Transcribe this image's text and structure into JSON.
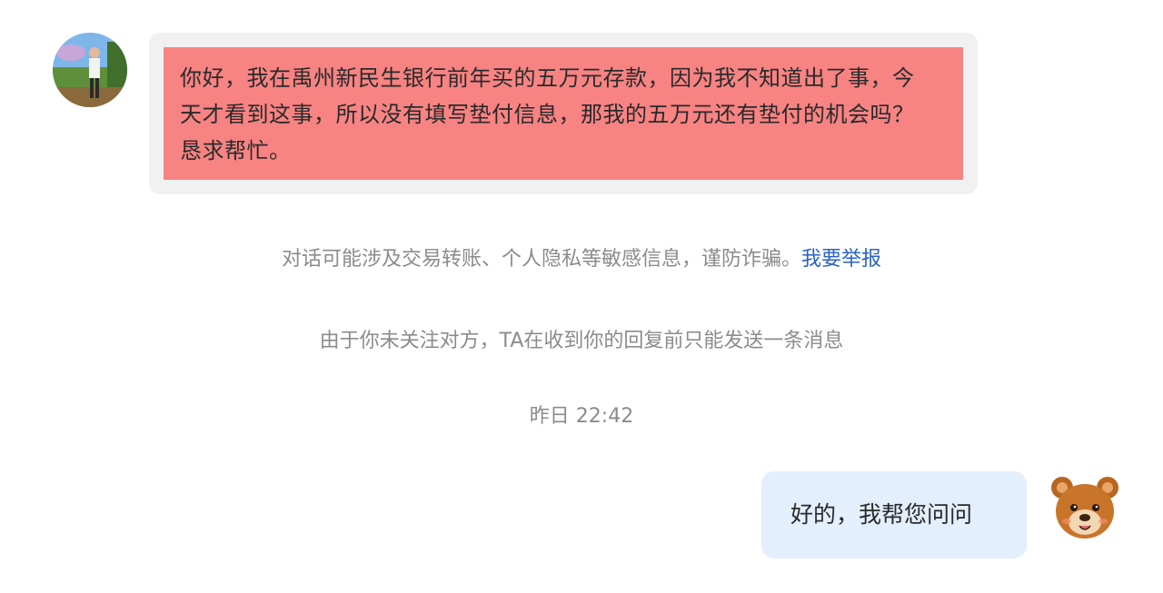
{
  "incoming_message": {
    "text": "你好，我在禹州新民生银行前年买的五万元存款，因为我不知道出了事，今天才看到这事，所以没有填写垫付信息，那我的五万元还有垫付的机会吗？恳求帮忙。"
  },
  "notices": {
    "fraud_warning": "对话可能涉及交易转账、个人隐私等敏感信息，谨防诈骗。",
    "report_link": "我要举报",
    "follow_limit": "由于你未关注对方，TA在收到你的回复前只能发送一条消息",
    "timestamp": "昨日 22:42"
  },
  "outgoing_message": {
    "text": "好的，我帮您问问"
  },
  "colors": {
    "incoming_bubble_frame": "#f1f1f1",
    "incoming_highlight": "#f78383",
    "outgoing_bubble": "#e4effd",
    "notice_text": "#8b8b8b",
    "link": "#2b62c5"
  }
}
